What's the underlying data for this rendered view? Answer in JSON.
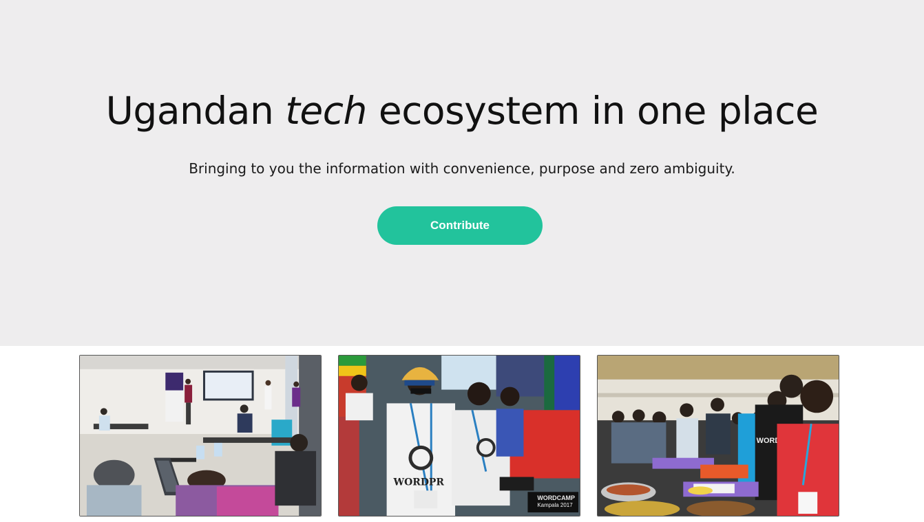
{
  "hero": {
    "title_before": "Ugandan",
    "title_emphasis": "tech",
    "title_after": "ecosystem in one place",
    "subtitle": "Bringing to you the information with convenience, purpose and zero ambiguity.",
    "cta_label": "Contribute"
  },
  "colors": {
    "hero_background": "#eeedee",
    "accent": "#22c39c"
  },
  "gallery": {
    "photos": [
      {
        "name": "meetup-presentation-photo"
      },
      {
        "name": "wordcamp-attendees-photo",
        "print": [
          "WORDPR",
          "WORDCAMP",
          "Kampala 2017"
        ]
      },
      {
        "name": "wordcamp-lunch-photo",
        "print": [
          "WORDCAM"
        ]
      }
    ]
  }
}
